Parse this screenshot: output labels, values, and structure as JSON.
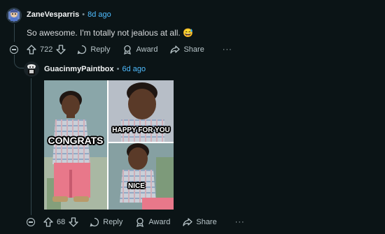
{
  "comment1": {
    "username": "ZaneVesparris",
    "separator": "•",
    "time": "8d ago",
    "text": "So awesome. I'm totally not jealous at all. 😅",
    "votes": "722",
    "reply_label": "Reply",
    "award_label": "Award",
    "share_label": "Share",
    "more_label": "···"
  },
  "comment2": {
    "username": "GuacinmyPaintbox",
    "separator": "•",
    "time": "6d ago",
    "votes": "68",
    "reply_label": "Reply",
    "award_label": "Award",
    "share_label": "Share",
    "more_label": "···"
  },
  "meme": {
    "caption_congrats": "CONGRATS",
    "caption_happy": "HAPPY FOR YOU",
    "caption_nice": "NICE"
  },
  "colors": {
    "background": "#0b1416",
    "time_link": "#4fbcff",
    "text": "#d7dadc"
  }
}
